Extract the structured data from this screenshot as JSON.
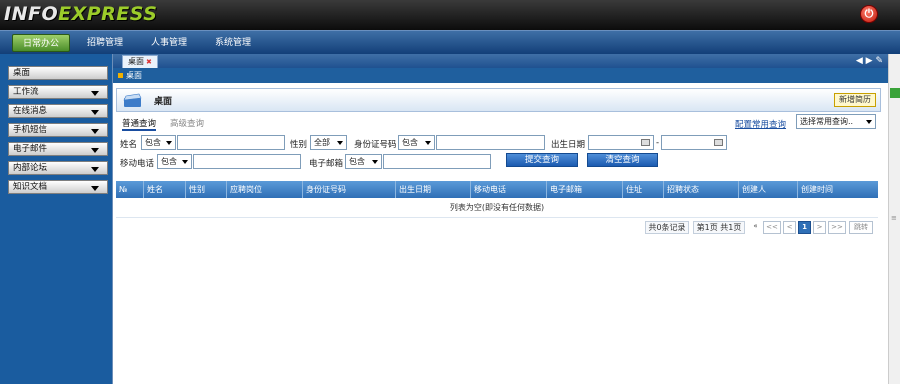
{
  "app": {
    "logo_a": "INFO",
    "logo_b": "EXPRESS",
    "power_icon": "power-icon"
  },
  "nav": {
    "tabs": [
      "日常办公",
      "招聘管理",
      "人事管理",
      "系统管理"
    ],
    "active": 0
  },
  "sidebar": {
    "items": [
      "桌面",
      "工作流",
      "在线消息",
      "手机短信",
      "电子邮件",
      "内部论坛",
      "知识文档"
    ]
  },
  "tabbar": {
    "tab_label": "桌面"
  },
  "breadcrumb": "桌面",
  "panel": {
    "title": "桌面",
    "new_button": "新增简历"
  },
  "query": {
    "tab_normal": "普通查询",
    "tab_advanced": "高级查询",
    "config_link": "配置常用查询",
    "common_select": "选择常用查询..",
    "name_label": "姓名",
    "name_op": "包含",
    "gender_label": "性别",
    "gender_value": "全部",
    "idcard_label": "身份证号码",
    "idcard_op": "包含",
    "birth_label": "出生日期",
    "mobile_label": "移动电话",
    "mobile_op": "包含",
    "email_label": "电子邮箱",
    "email_op": "包含",
    "submit": "提交查询",
    "clear": "清空查询"
  },
  "table": {
    "columns": [
      "№",
      "姓名",
      "性别",
      "应聘岗位",
      "身份证号码",
      "出生日期",
      "移动电话",
      "电子邮箱",
      "住址",
      "招聘状态",
      "创建人",
      "创建时间"
    ],
    "empty_text": "列表为空(即没有任何数据)"
  },
  "pager": {
    "records": "共0条记录",
    "pages": "第1页 共1页",
    "dots": "«",
    "first": "<<",
    "prev": "<",
    "current": "1",
    "next": ">",
    "last": ">>",
    "jump": "跳转"
  },
  "colors": {
    "nav": "#1a4f8f",
    "sidebar": "#1a5c9f",
    "accent_green": "#4b8d2a",
    "header_blue": "#2f6fb6"
  }
}
